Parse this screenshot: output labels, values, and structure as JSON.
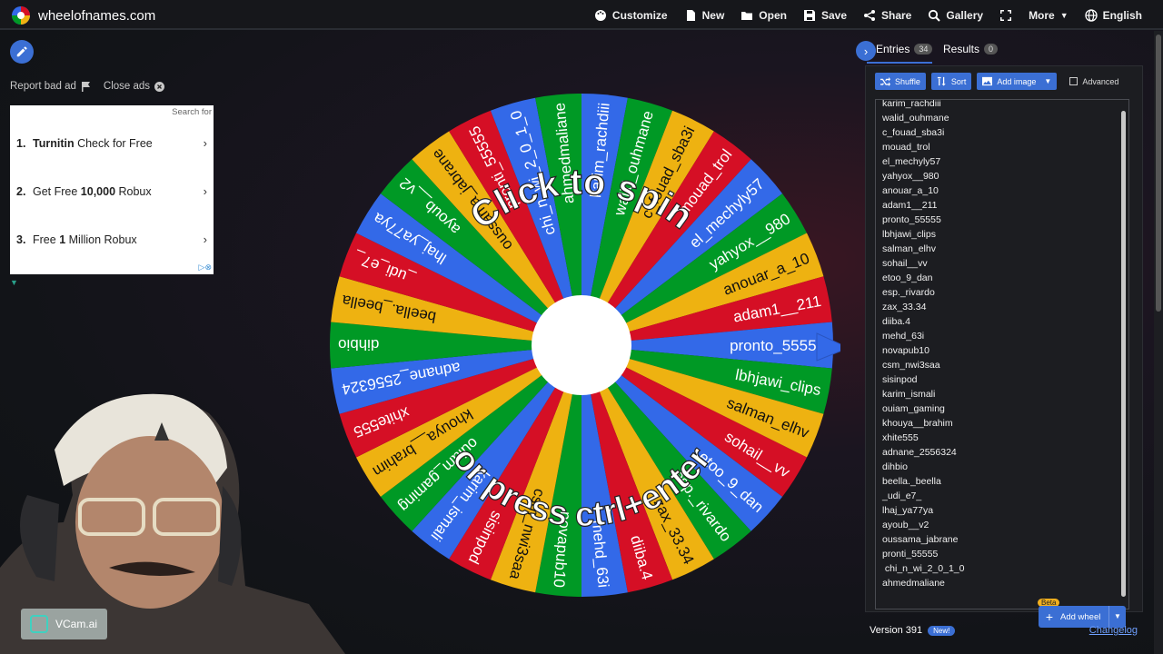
{
  "brand": {
    "name": "wheelofnames.com"
  },
  "nav": [
    {
      "label": "Customize",
      "icon": "palette-icon"
    },
    {
      "label": "New",
      "icon": "file-icon"
    },
    {
      "label": "Open",
      "icon": "folder-icon"
    },
    {
      "label": "Save",
      "icon": "floppy-icon"
    },
    {
      "label": "Share",
      "icon": "share-icon"
    },
    {
      "label": "Gallery",
      "icon": "search-icon"
    },
    {
      "label": "",
      "icon": "fullscreen-icon"
    },
    {
      "label": "More",
      "icon": "chevron-down-icon"
    },
    {
      "label": "English",
      "icon": "globe-icon"
    }
  ],
  "ads": {
    "report": "Report bad ad",
    "close": "Close ads",
    "search": "Search for",
    "items": [
      {
        "num": "1.",
        "bold": "Turnitin",
        "text": " Check for Free"
      },
      {
        "num": "2.",
        "pre": "Get Free ",
        "bold": "10,000",
        "text": " Robux"
      },
      {
        "num": "3.",
        "pre": "Free ",
        "bold": "1",
        "text": " Million Robux"
      }
    ]
  },
  "webcam": {
    "watermark": "VCam.ai"
  },
  "wheel": {
    "top_text": "Click to spin",
    "bottom_text": "or press ctrl+enter",
    "colors": [
      "#3369e8",
      "#009925",
      "#eeb211",
      "#d50f25"
    ],
    "pointer_color": "#3369e8"
  },
  "panel": {
    "tab_entries": "Entries",
    "entries_count": "34",
    "tab_results": "Results",
    "results_count": "0",
    "shuffle": "Shuffle",
    "sort": "Sort",
    "add_image": "Add image",
    "advanced": "Advanced",
    "add_wheel": "Add wheel",
    "beta": "Beta",
    "version": "Version 391",
    "new_badge": "New!",
    "changelog": "Changelog"
  },
  "entries": [
    "karim_rachdiii",
    "walid_ouhmane",
    "c_fouad_sba3i",
    "mouad_trol",
    "el_mechyly57",
    "yahyox__980",
    "anouar_a_10",
    "adam1__211",
    "pronto_55555",
    "lbhjawi_clips",
    "salman_elhv",
    "sohail__vv",
    "etoo_9_dan",
    "esp._rivardo",
    "zax_33.34",
    "diiba.4",
    "mehd_63i",
    "novapub10",
    "csm_nwi3saa",
    "sisinpod",
    "karim_ismali",
    "ouiam_gaming",
    "khouya__brahim",
    "xhite555",
    "adnane_2556324",
    "dihbio",
    "beella._beella",
    "_udi_e7_",
    "lhaj_ya77ya",
    "ayoub__v2",
    "oussama_jabrane",
    "pronti_55555",
    " chi_n_wi_2_0_1_0",
    "ahmedmaliane"
  ]
}
